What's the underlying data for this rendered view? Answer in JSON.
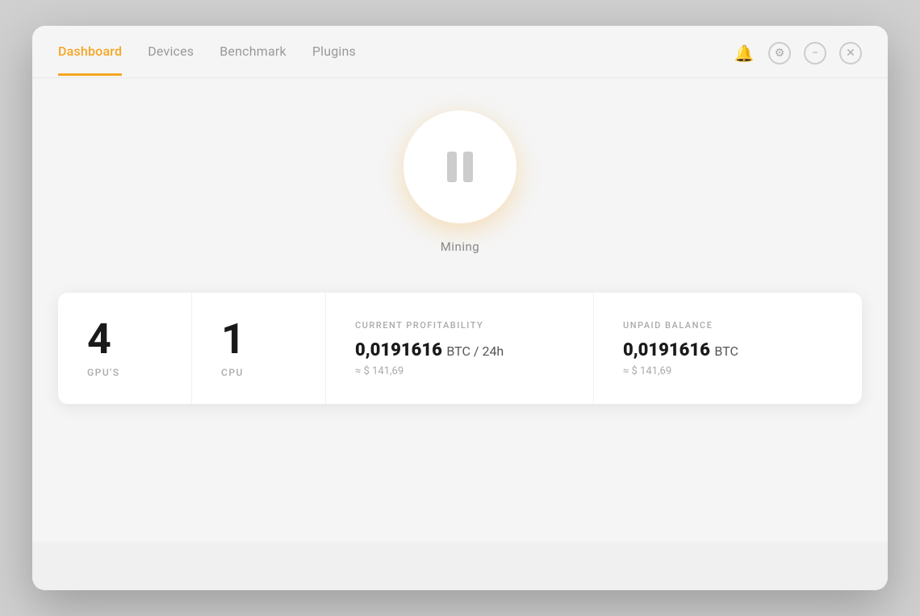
{
  "nav": {
    "tabs": [
      {
        "id": "dashboard",
        "label": "Dashboard",
        "active": true
      },
      {
        "id": "devices",
        "label": "Devices",
        "active": false
      },
      {
        "id": "benchmark",
        "label": "Benchmark",
        "active": false
      },
      {
        "id": "plugins",
        "label": "Plugins",
        "active": false
      }
    ]
  },
  "window_controls": {
    "bell_icon": "🔔",
    "settings_icon": "⚙",
    "minimize_icon": "−",
    "close_icon": "✕"
  },
  "mining": {
    "status_label": "Mining",
    "button_state": "paused"
  },
  "stats": {
    "gpu_count": "4",
    "gpu_label": "GPU'S",
    "cpu_count": "1",
    "cpu_label": "CPU",
    "profitability": {
      "title": "CURRENT PROFITABILITY",
      "value": "0,0191616",
      "unit": "BTC / 24h",
      "usd_approx": "≈ $ 141,69"
    },
    "unpaid_balance": {
      "title": "UNPAID BALANCE",
      "value": "0,0191616",
      "unit": "BTC",
      "usd_approx": "≈ $ 141,69"
    }
  },
  "footer": {
    "text": ""
  },
  "colors": {
    "accent": "#f5a623",
    "text_primary": "#1a1a1a",
    "text_muted": "#aaa",
    "border": "#f0f0f0"
  }
}
